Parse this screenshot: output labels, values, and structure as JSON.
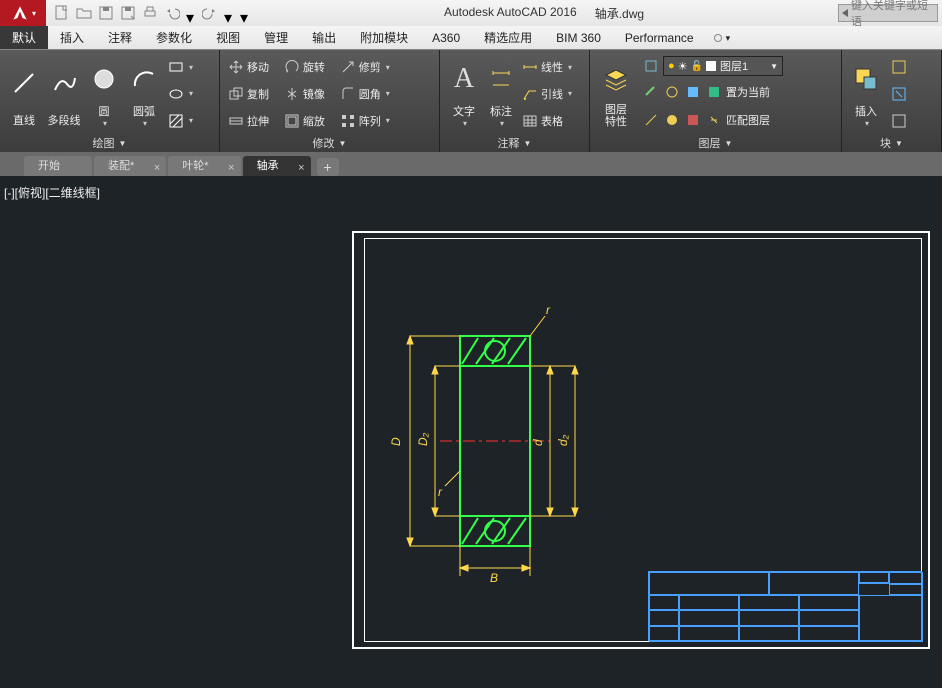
{
  "title": {
    "appname": "Autodesk AutoCAD 2016",
    "filename": "轴承.dwg"
  },
  "search_placeholder": "键入关键字或短语",
  "ribbon_tabs": [
    "默认",
    "插入",
    "注释",
    "参数化",
    "视图",
    "管理",
    "输出",
    "附加模块",
    "A360",
    "精选应用",
    "BIM 360",
    "Performance"
  ],
  "panels": {
    "draw": {
      "label": "绘图",
      "big": [
        "直线",
        "多段线",
        "圆",
        "圆弧"
      ]
    },
    "modify": {
      "label": "修改",
      "rows": [
        [
          "移动",
          "旋转",
          "修剪"
        ],
        [
          "复制",
          "镜像",
          "圆角"
        ],
        [
          "拉伸",
          "缩放",
          "阵列"
        ]
      ]
    },
    "annotate": {
      "label": "注释",
      "big": "文字",
      "rows": [
        "标注",
        "线性",
        "引线",
        "表格"
      ]
    },
    "layers": {
      "label": "图层",
      "big": "图层\n特性",
      "combo": "图层1",
      "rows": [
        "置为当前",
        "匹配图层"
      ]
    },
    "block": {
      "label": "块",
      "big": "插入"
    }
  },
  "doc_tabs": [
    {
      "label": "开始",
      "active": false,
      "dirty": false,
      "closable": false
    },
    {
      "label": "装配*",
      "active": false,
      "dirty": true,
      "closable": true
    },
    {
      "label": "叶轮*",
      "active": false,
      "dirty": true,
      "closable": true
    },
    {
      "label": "轴承",
      "active": true,
      "dirty": false,
      "closable": true
    }
  ],
  "viewport_label": "[-][俯视][二维线框]",
  "dims": {
    "D": "D",
    "D2": "D₂",
    "d": "d",
    "d2": "d₂",
    "B": "B",
    "r": "r",
    "r2": "r"
  }
}
